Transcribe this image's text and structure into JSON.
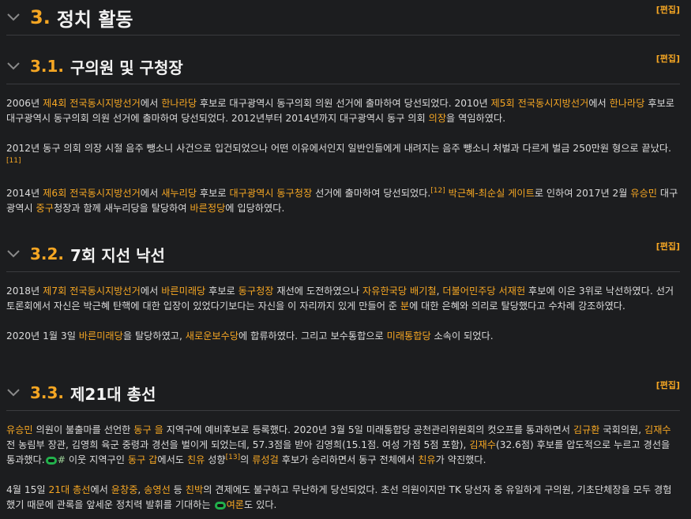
{
  "edit_label": "[편집]",
  "s3": {
    "num": "3.",
    "title": "정치 활동"
  },
  "s31": {
    "num": "3.1.",
    "title": "구의원 및 구청장",
    "p1": {
      "a": "2006년 ",
      "l1": "제4회 전국동시지방선거",
      "b": "에서 ",
      "l2": "한나라당",
      "c": " 후보로 대구광역시 동구의회 의원 선거에 출마하여 당선되었다. 2010년 ",
      "l3": "제5회 전국동시지방선거",
      "d": "에서 ",
      "l4": "한나라당",
      "e": " 후보로 대구광역시 동구의회 의원 선거에 출마하여 당선되었다. 2012년부터 2014년까지 대구광역시 동구 의회 ",
      "l5": "의장",
      "f": "을 역임하였다."
    },
    "p2": {
      "a": "2012년 동구 의회 의장 시절 음주 뺑소니 사건으로 입건되었으나 어떤 이유에서인지 일반인들에게 내려지는 음주 뺑소니 처벌과 다르게 벌금 250만원 형으로 끝났다.",
      "ref": "[11]"
    },
    "p3": {
      "a": "2014년 ",
      "l1": "제6회 전국동시지방선거",
      "b": "에서 ",
      "l2": "새누리당",
      "c": " 후보로 ",
      "l3": "대구광역시 동구청장",
      "d": " 선거에 출마하여 당선되었다.",
      "ref": "[12]",
      "e": " ",
      "l4": "박근혜-최순실 게이트",
      "f": "로 인하여 2017년 2월 ",
      "l5": "유승민",
      "g": " 대구광역시 ",
      "l6": "중구",
      "h": "청장과 함께 새누리당을 탈당하여 ",
      "l7": "바른정당",
      "i": "에 입당하였다."
    }
  },
  "s32": {
    "num": "3.2.",
    "title": "7회 지선 낙선",
    "p1": {
      "a": "2018년 ",
      "l1": "제7회 전국동시지방선거",
      "b": "에서 ",
      "l2": "바른미래당",
      "c": " 후보로 ",
      "l3": "동구청장",
      "d": " 재선에 도전하였으나 ",
      "l4": "자유한국당 배기철",
      "e": ", ",
      "l5": "더불어민주당 서재헌",
      "f": " 후보에 이은 3위로 낙선하였다. 선거 토론회에서 자신은 박근혜 탄핵에 대한 입장이 있었다기보다는 자신을 이 자리까지 있게 만들어 준 ",
      "l6": "분",
      "g": "에 대한 은혜와 의리로 탈당했다고 수차례 강조하였다."
    },
    "p2": {
      "a": "2020년 1월 3일 ",
      "l1": "바른미래당",
      "b": "을 탈당하였고, ",
      "l2": "새로운보수당",
      "c": "에 합류하였다. 그리고 보수통합으로 ",
      "l3": "미래통합당",
      "d": " 소속이 되었다."
    }
  },
  "s33": {
    "num": "3.3.",
    "title": "제21대 총선",
    "p1": {
      "l1": "유승민",
      "a": " 의원이 불출마를 선언한 ",
      "l2": "동구 을",
      "b": " 지역구에 예비후보로 등록했다. 2020년 3월 5일 미래통합당 공천관리위원회의 컷오프를 통과하면서 ",
      "l3": "김규환",
      "c": " 국회의원, ",
      "l4": "김재수",
      "d": " 전 농림부 장관, 김영희 육군 중령과 경선을 벌이게 되었는데, 57.3점을 받아 김영희(15.1점. 여성 가점 5점 포함), ",
      "l5": "김재수",
      "e": "(32.6점) 후보를 압도적으로 누르고 경선을 통과했다.",
      "hash": "#",
      "f": " 이웃 지역구인 ",
      "l6": "동구 갑",
      "g": "에서도 ",
      "l7": "친유",
      "h": " 성향",
      "ref": "[13]",
      "i": "의 ",
      "l8": "류성걸",
      "j": " 후보가 승리하면서 동구 전체에서 ",
      "l9": "친유",
      "k": "가 약진했다."
    },
    "p2": {
      "a": "4월 15일 ",
      "l1": "21대 총선",
      "b": "에서 ",
      "l2": "윤창중",
      "c": ", ",
      "l3": "송영선",
      "d": " 등 ",
      "l4": "친박",
      "e": "의 견제에도 불구하고 무난하게 당선되었다. 초선 의원이지만 TK 당선자 중 유일하게 구의원, 기초단체장을 모두 경험했기 때문에 관록을 앞세운 정치력 발휘를 기대하는 ",
      "l5": "여론",
      "f": "도 있다."
    }
  }
}
